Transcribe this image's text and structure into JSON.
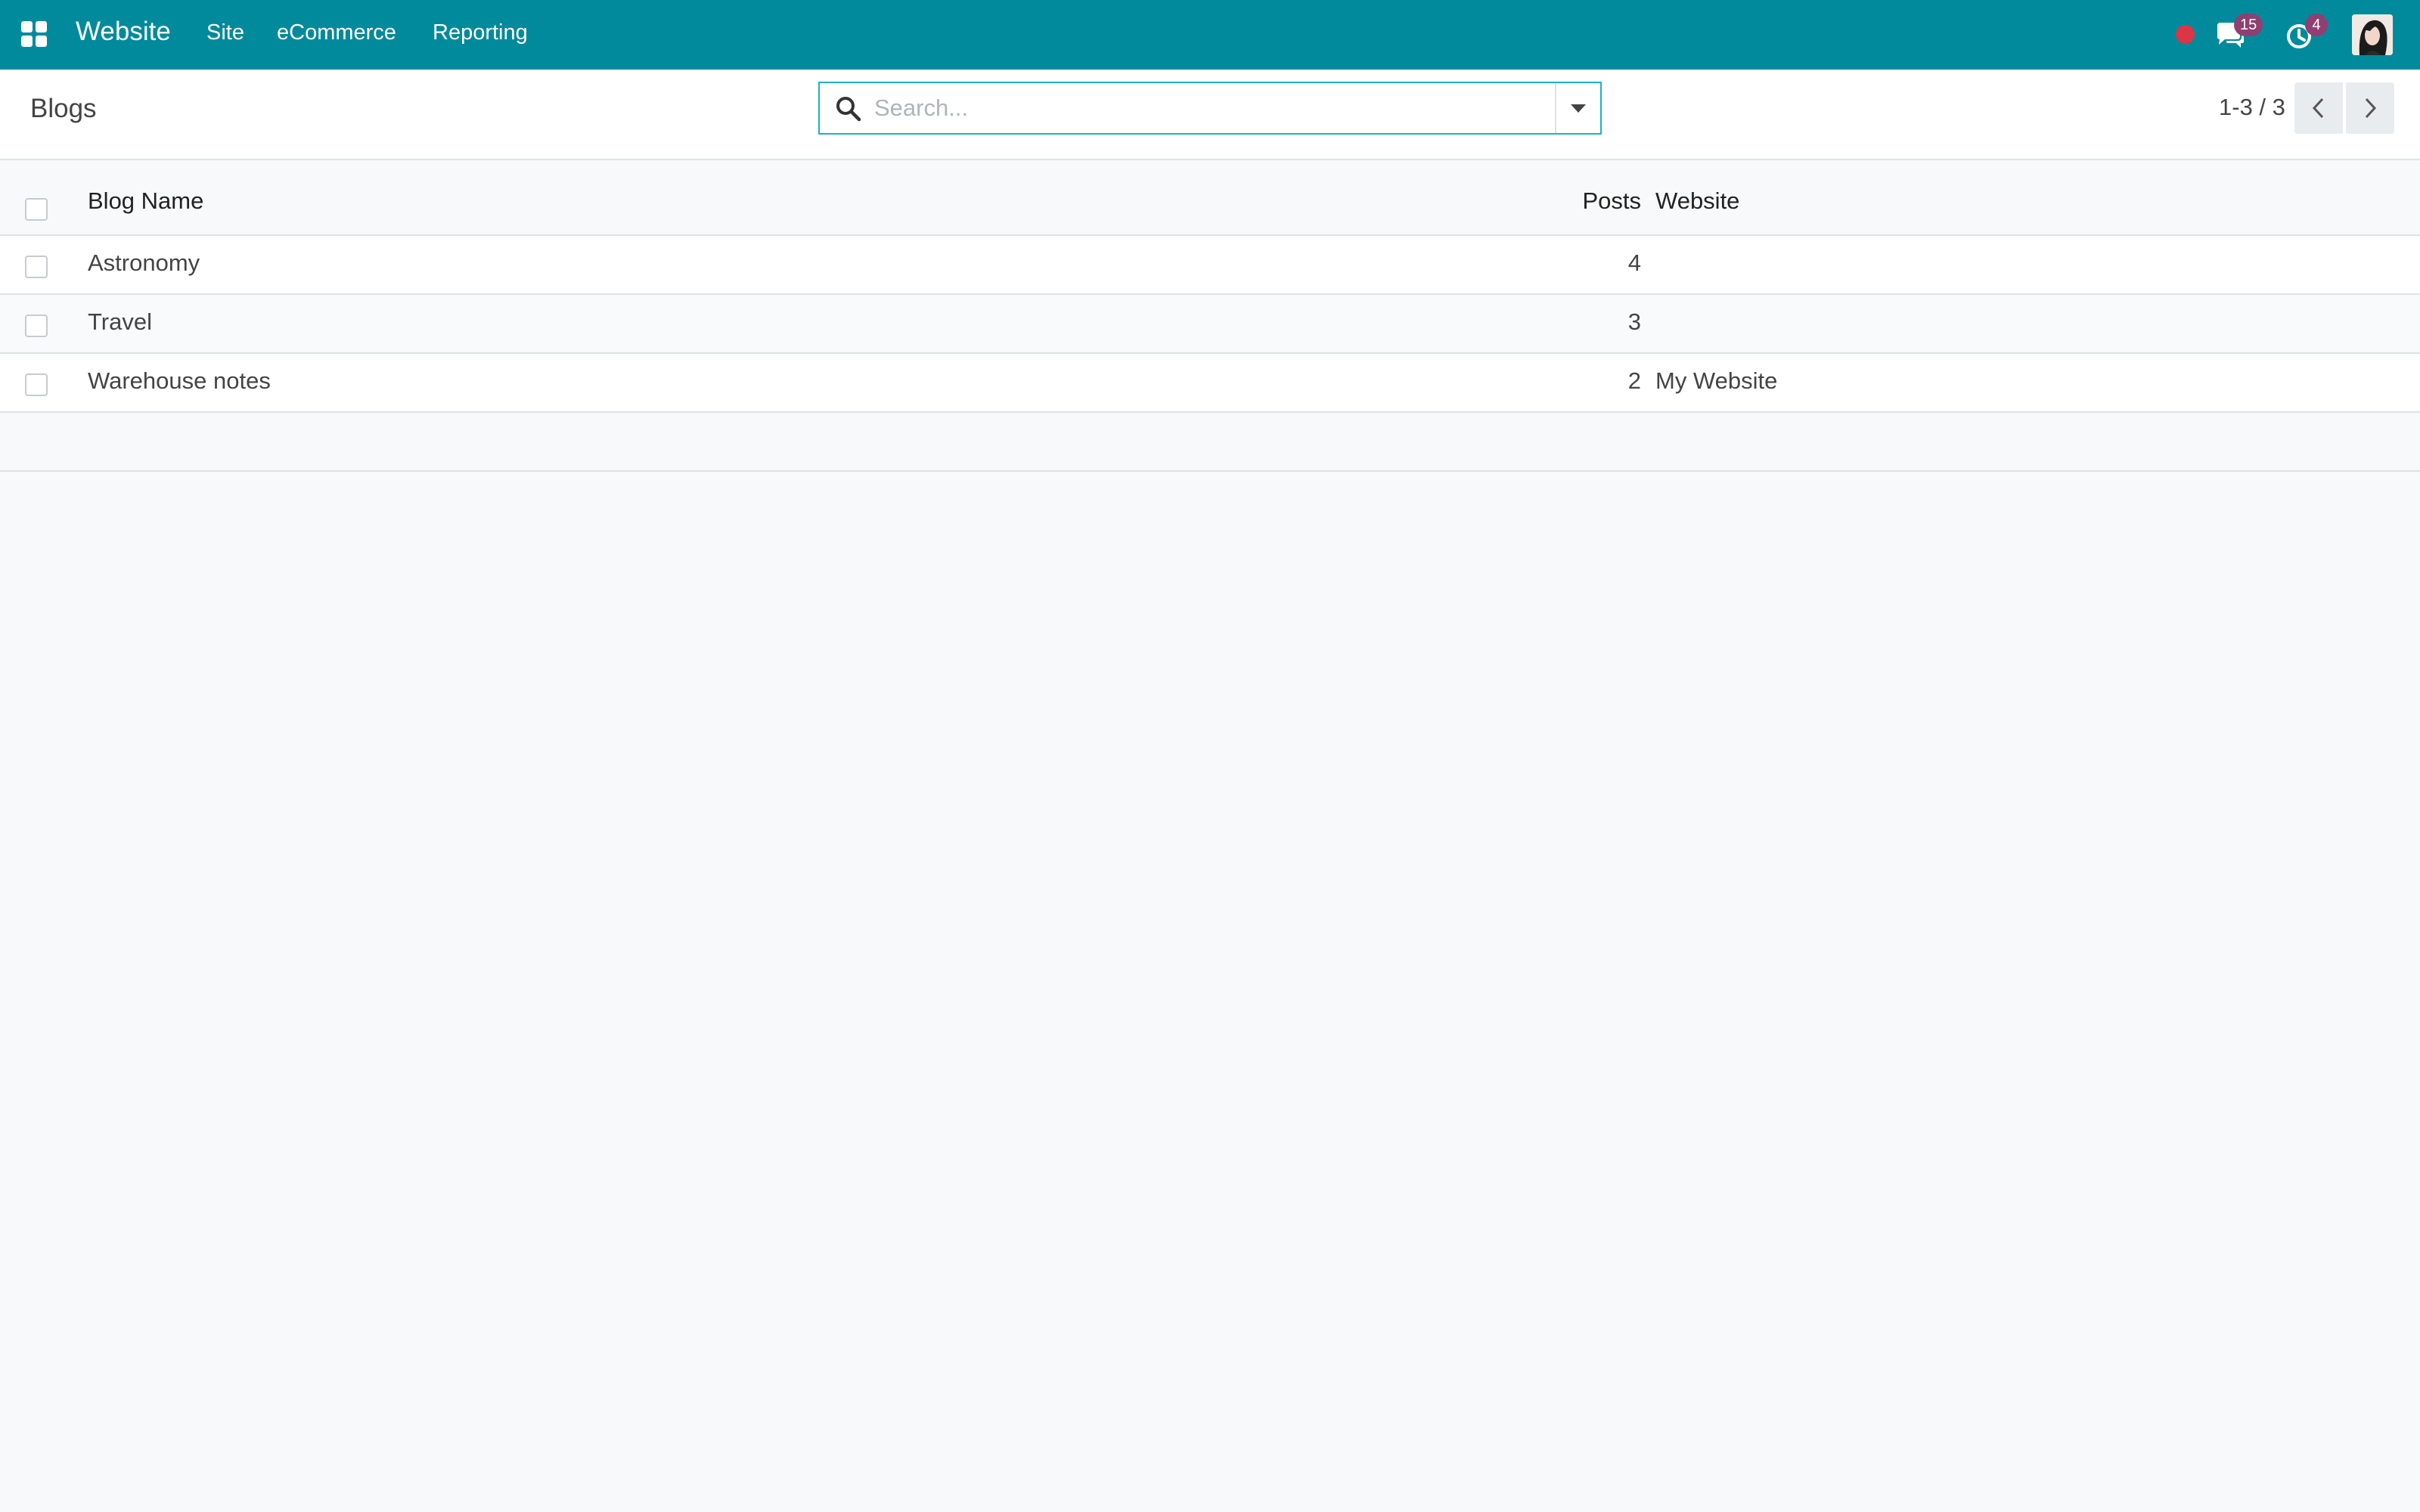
{
  "navbar": {
    "app_name": "Website",
    "menus": [
      "Site",
      "eCommerce",
      "Reporting"
    ],
    "messages_count": "15",
    "activities_count": "4",
    "bg_color": "#008a9c",
    "status_color": "#dc3545"
  },
  "control_panel": {
    "breadcrumb": "Blogs",
    "search_placeholder": "Search...",
    "pager": "1-3 / 3"
  },
  "table": {
    "columns": {
      "name": "Blog Name",
      "posts": "Posts",
      "website": "Website"
    },
    "rows": [
      {
        "name": "Astronomy",
        "posts": "4",
        "website": ""
      },
      {
        "name": "Travel",
        "posts": "3",
        "website": ""
      },
      {
        "name": "Warehouse notes",
        "posts": "2",
        "website": "My Website"
      }
    ]
  },
  "icons": {
    "apps": "apps-grid-icon",
    "messages": "chat-icon",
    "activities": "clock-icon",
    "search": "search-icon",
    "dropdown": "caret-down-icon",
    "prev": "chevron-left-icon",
    "next": "chevron-right-icon"
  }
}
